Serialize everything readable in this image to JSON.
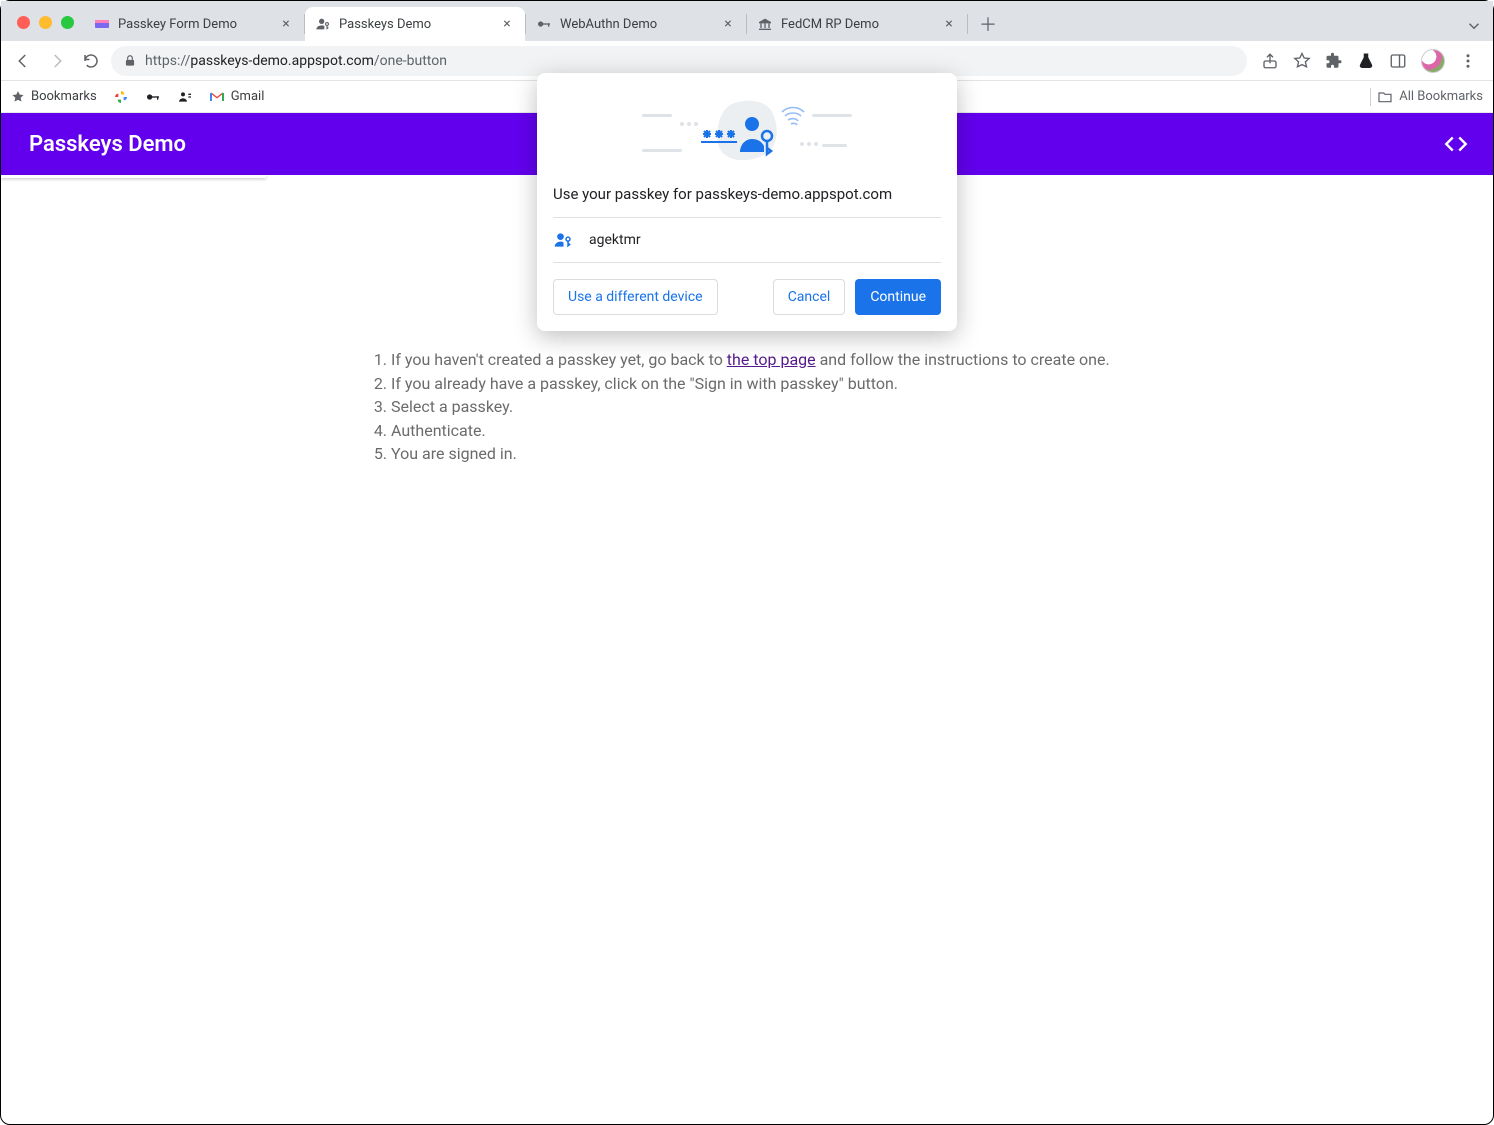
{
  "browser": {
    "tabs": [
      {
        "title": "Passkey Form Demo"
      },
      {
        "title": "Passkeys Demo"
      },
      {
        "title": "WebAuthn Demo"
      },
      {
        "title": "FedCM RP Demo"
      }
    ],
    "url": {
      "protocol": "https://",
      "host": "passkeys-demo.appspot.com",
      "path": "/one-button"
    },
    "bookmarks": {
      "label": "Bookmarks",
      "gmail": "Gmail",
      "all": "All Bookmarks"
    }
  },
  "page": {
    "title": "Passkeys Demo",
    "instructions": {
      "i1a": "If you haven't created a passkey yet, go back to ",
      "i1link": "the top page",
      "i1b": " and follow the instructions to create one.",
      "i2": "If you already have a passkey, click on the \"Sign in with passkey\" button.",
      "i3": "Select a passkey.",
      "i4": "Authenticate.",
      "i5": "You are signed in."
    }
  },
  "dialog": {
    "title": "Use your passkey for passkeys-demo.appspot.com",
    "account": "agektmr",
    "buttons": {
      "different": "Use a different device",
      "cancel": "Cancel",
      "continue": "Continue"
    }
  }
}
